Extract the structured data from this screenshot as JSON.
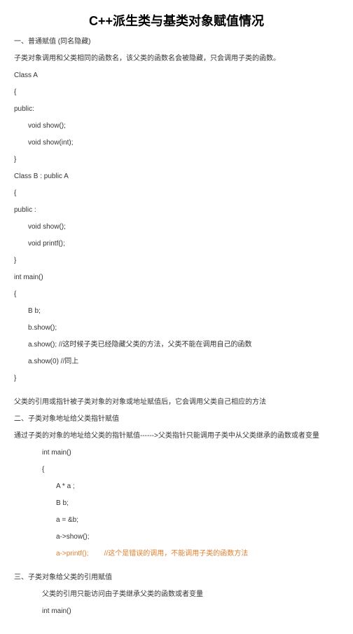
{
  "title": "C++派生类与基类对象赋值情况",
  "section1": {
    "head": "一、普通赋值 (同名隐藏)",
    "desc": "子类对象调用和父类相同的函数名，该父类的函数名会被隐藏，只会调用子类的函数。",
    "code": {
      "l1": "Class A",
      "l2": "{",
      "l3": "public:",
      "l4": "void show();",
      "l5": "void show(int);",
      "l6": "}",
      "l7": "Class B : public A",
      "l8": "{",
      "l9": "public :",
      "l10": "void show();",
      "l11": "void printf();",
      "l12": "}",
      "l13": "int main()",
      "l14": "{",
      "l15": "B b;",
      "l16": "b.show();",
      "l17": "a.show();        //这时候子类已经隐藏父类的方法，父类不能在调用自己的函数",
      "l18": "a.show(0)      //同上",
      "l19": "}"
    }
  },
  "section2_pre": "父类的引用或指针被子类对象的对象或地址赋值后，它会调用父类自己相应的方法",
  "section2": {
    "head": "二、子类对象地址给父类指针赋值",
    "desc": "通过子类的对象的地址给父类的指针赋值------>父类指针只能调用子类中从父类继承的函数或者变量",
    "code": {
      "l1": "int main()",
      "l2": "{",
      "l3": "A * a ;",
      "l4": "B b;",
      "l5": "a = &b;",
      "l6": "a->show();",
      "l7a": "a->printf();",
      "l7b": "//这个是错误的调用，不能调用子类的函数方法"
    }
  },
  "section3": {
    "head": "三、子类对象给父类的引用赋值",
    "desc": "父类的引用只能访问由子类继承父类的函数或者变量",
    "code": {
      "l1": "int main()"
    }
  }
}
